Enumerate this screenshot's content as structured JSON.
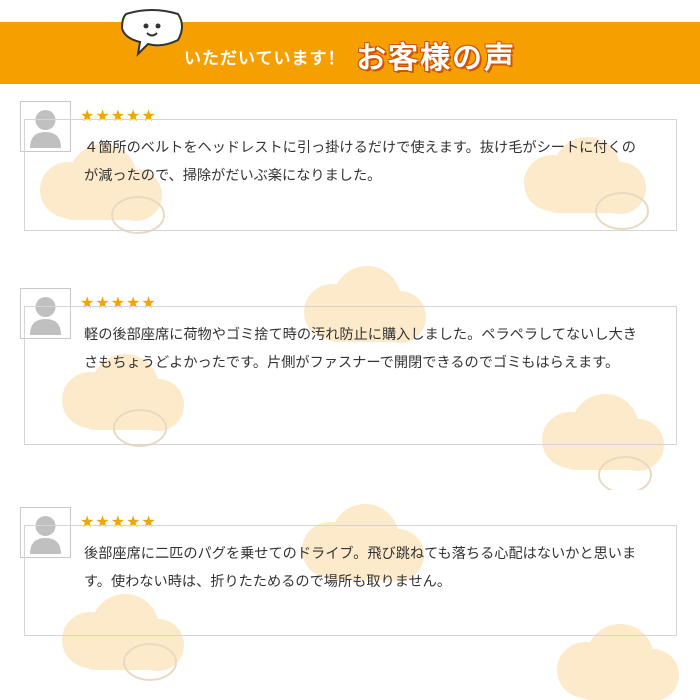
{
  "header": {
    "lead": "いただいています！",
    "title": "お客様の声",
    "background_color": "#f5a000",
    "mascot_icon": "speech-bubble-face-icon"
  },
  "reviews": [
    {
      "avatar_icon": "user-silhouette-icon",
      "stars": "★★★★★",
      "rating": 5,
      "text": "４箇所のベルトをヘッドレストに引っ掛けるだけで使えます。抜け毛がシートに付くのが減ったので、掃除がだいぶ楽になりました。"
    },
    {
      "avatar_icon": "user-silhouette-icon",
      "stars": "★★★★★",
      "rating": 5,
      "text": "軽の後部座席に荷物やゴミ捨て時の汚れ防止に購入しました。ペラペラしてないし大きさもちょうどよかったです。片側がファスナーで開閉できるのでゴミもはらえます。"
    },
    {
      "avatar_icon": "user-silhouette-icon",
      "stars": "★★★★★",
      "rating": 5,
      "text": "後部座席に二匹のパグを乗せてのドライブ。飛び跳ねても落ちる心配はないかと思います。使わない時は、折りたためるので場所も取りません。"
    }
  ],
  "colors": {
    "accent": "#f5a000",
    "star": "#f0a500",
    "cloud": "#fde9c9"
  }
}
